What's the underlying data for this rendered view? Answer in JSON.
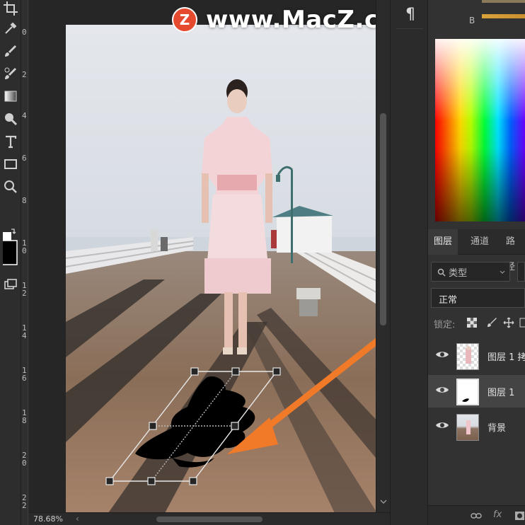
{
  "watermark": {
    "logo_letter": "Z",
    "text": "www.MacZ.com"
  },
  "ruler": {
    "labels": [
      "0",
      "2",
      "4",
      "6",
      "8",
      "1\n0",
      "1\n2",
      "1\n4",
      "1\n6",
      "1\n8",
      "2\n0",
      "2\n2"
    ]
  },
  "status": {
    "zoom": "78.68%",
    "scroll_left": "‹"
  },
  "panel_para": {
    "glyph": "¶"
  },
  "color_panel": {
    "channel_label": "B"
  },
  "layers_panel": {
    "tabs": [
      "图层",
      "通道",
      "路径"
    ],
    "filter_label": "类型",
    "blend_mode": "正常",
    "lock_label": "锁定:",
    "layers": [
      {
        "name": "图层 1 拷",
        "selected": false
      },
      {
        "name": "图层 1",
        "selected": true
      },
      {
        "name": "背景",
        "selected": false
      }
    ],
    "footer": {
      "link": "⊖",
      "fx": "fx"
    }
  },
  "colors": {
    "accent_arrow": "#f07a28",
    "selection": "#444444",
    "panel_bg": "#323232"
  }
}
